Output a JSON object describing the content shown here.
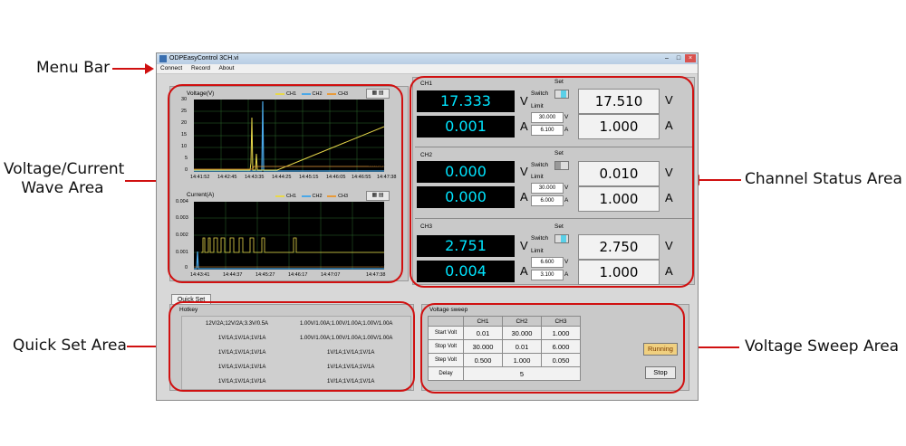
{
  "callouts": {
    "menu_bar": "Menu Bar",
    "wave_area": "Voltage/Current\nWave Area",
    "quick_set_area": "Quick Set Area",
    "channel_status_area": "Channel Status Area",
    "voltage_sweep_area": "Voltage Sweep Area"
  },
  "window": {
    "title": "ODPEasyControl 3CH.vi",
    "menu": [
      "Connect",
      "Record",
      "About"
    ]
  },
  "voltage_chart": {
    "title": "Voltage(V)",
    "legend": [
      "CH1",
      "CH2",
      "CH3"
    ],
    "y_ticks": [
      "30",
      "25",
      "20",
      "15",
      "10",
      "5",
      "0"
    ],
    "x_ticks": [
      "14:41:52",
      "14:42:45",
      "14:43:35",
      "14:44:25",
      "14:45:15",
      "14:46:05",
      "14:46:55",
      "14:47:38"
    ],
    "x_label": "Time(s)"
  },
  "current_chart": {
    "title": "Current(A)",
    "legend": [
      "CH1",
      "CH2",
      "CH3"
    ],
    "y_ticks": [
      "0.004",
      "0.003",
      "0.002",
      "0.001",
      "0"
    ],
    "x_ticks": [
      "14:43:41",
      "14:44:37",
      "14:45:27",
      "14:46:17",
      "14:47:07",
      "14:47:38"
    ],
    "x_label": "Time(s)"
  },
  "channels": [
    {
      "name": "CH1",
      "voltage": "17.333",
      "current": "0.001",
      "set_label": "Set",
      "switch_label": "Switch",
      "limit_label": "Limit",
      "limit_v": "30.000",
      "limit_a": "6.100",
      "set_voltage": "17.510",
      "set_current": "1.000",
      "switch_on": true
    },
    {
      "name": "CH2",
      "voltage": "0.000",
      "current": "0.000",
      "set_label": "Set",
      "switch_label": "Switch",
      "limit_label": "Limit",
      "limit_v": "30.000",
      "limit_a": "6.000",
      "set_voltage": "0.010",
      "set_current": "1.000",
      "switch_on": false
    },
    {
      "name": "CH3",
      "voltage": "2.751",
      "current": "0.004",
      "set_label": "Set",
      "switch_label": "Switch",
      "limit_label": "Limit",
      "limit_v": "6.600",
      "limit_a": "3.100",
      "set_voltage": "2.750",
      "set_current": "1.000",
      "switch_on": true
    }
  ],
  "units": {
    "v": "V",
    "a": "A"
  },
  "quick_set": {
    "tab": "Quick Set",
    "group": "Hotkey",
    "rows": [
      [
        "12V/2A;12V/2A;3.3V/0.5A",
        "1.00V/1.00A;1.00V/1.00A;1.00V/1.00A"
      ],
      [
        "1V/1A;1V/1A;1V/1A",
        "1.00V/1.00A;1.00V/1.00A;1.00V/1.00A"
      ],
      [
        "1V/1A;1V/1A;1V/1A",
        "1V/1A;1V/1A;1V/1A"
      ],
      [
        "1V/1A;1V/1A;1V/1A",
        "1V/1A;1V/1A;1V/1A"
      ],
      [
        "1V/1A;1V/1A;1V/1A",
        "1V/1A;1V/1A;1V/1A"
      ]
    ]
  },
  "voltage_sweep": {
    "title": "Voltage sweep",
    "columns": [
      "CH1",
      "CH2",
      "CH3"
    ],
    "rows": [
      {
        "label": "Start Volt",
        "values": [
          "0.01",
          "30.000",
          "1.000"
        ]
      },
      {
        "label": "Stop Volt",
        "values": [
          "30.000",
          "0.01",
          "6.000"
        ]
      },
      {
        "label": "Step Volt",
        "values": [
          "0.500",
          "1.000",
          "0.050"
        ]
      }
    ],
    "delay_label": "Delay",
    "delay_value": "5",
    "running_label": "Running",
    "stop_label": "Stop"
  },
  "colors": {
    "ch1": "#e8d84a",
    "ch2": "#4aa8e8",
    "ch3": "#e89a3a",
    "display": "#00e5ff",
    "annotation": "#d01010"
  }
}
